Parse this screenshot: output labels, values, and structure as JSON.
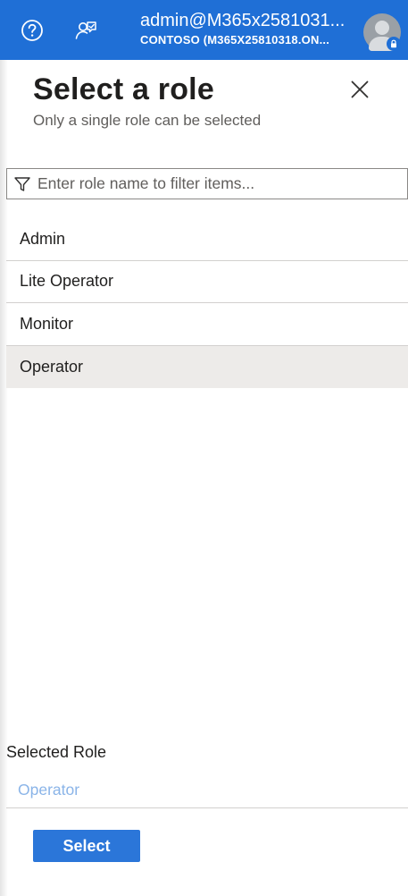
{
  "topbar": {
    "account_email": "admin@M365x2581031...",
    "account_tenant": "CONTOSO (M365X25810318.ON...",
    "icons": [
      "help-icon",
      "feedback-icon",
      "avatar",
      "lock-icon"
    ],
    "background": "#1f6fd6"
  },
  "panel": {
    "title": "Select a role",
    "subtitle": "Only a single role can be selected",
    "filter": {
      "placeholder": "Enter role name to filter items...",
      "value": ""
    },
    "roles": [
      {
        "label": "Admin",
        "selected": false
      },
      {
        "label": "Lite Operator",
        "selected": false
      },
      {
        "label": "Monitor",
        "selected": false
      },
      {
        "label": "Operator",
        "selected": true
      }
    ],
    "selected_role_label": "Selected Role",
    "selected_role_value": "Operator",
    "select_button_label": "Select",
    "accent": "#2b76d9"
  }
}
